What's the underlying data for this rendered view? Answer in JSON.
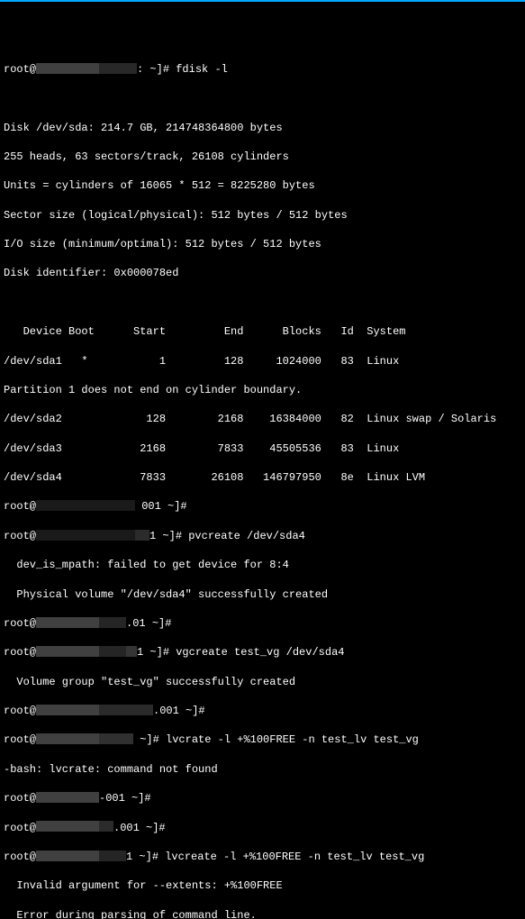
{
  "prompt": {
    "user": "root@",
    "tail1": ": ~]# ",
    "tail2": " ~]# ",
    "tail3": "-001 ~]# "
  },
  "cmd": {
    "fdisk": "fdisk -l",
    "pvcreate": "pvcreate /dev/sda4",
    "vgcreate": "vgcreate test_vg /dev/sda4",
    "lvcrate": "lvcrate -l +%100FREE -n test_lv test_vg",
    "lvcreate": "lvcreate -l +%100FREE -n test_lv test_vg"
  },
  "fdisk": {
    "disk": "Disk /dev/sda: 214.7 GB, 214748364800 bytes",
    "heads": "255 heads, 63 sectors/track, 26108 cylinders",
    "units": "Units = cylinders of 16065 * 512 = 8225280 bytes",
    "sector": "Sector size (logical/physical): 512 bytes / 512 bytes",
    "io": "I/O size (minimum/optimal): 512 bytes / 512 bytes",
    "ident": "Disk identifier: 0x000078ed",
    "header": "   Device Boot      Start         End      Blocks   Id  System",
    "r1": "/dev/sda1   *           1         128     1024000   83  Linux",
    "note": "Partition 1 does not end on cylinder boundary.",
    "r2": "/dev/sda2             128        2168    16384000   82  Linux swap / Solaris",
    "r3": "/dev/sda3            2168        7833    45505536   83  Linux",
    "r4": "/dev/sda4            7833       26108   146797950   8e  Linux LVM"
  },
  "msg": {
    "mpath": "  dev_is_mpath: failed to get device for 8:4",
    "pvok": "  Physical volume \"/dev/sda4\" successfully created",
    "vgok": "  Volume group \"test_vg\" successfully created",
    "bashnf": "-bash: lvcrate: command not found",
    "invext": "  Invalid argument for --extents: +%100FREE",
    "parseerr": "  Error during parsing of command line."
  },
  "suffix": {
    "h001": "001 ~]#",
    "one": "1 ~]# ",
    "dot1": ".01 ~]#",
    "h001b": ".001 ~]#"
  }
}
